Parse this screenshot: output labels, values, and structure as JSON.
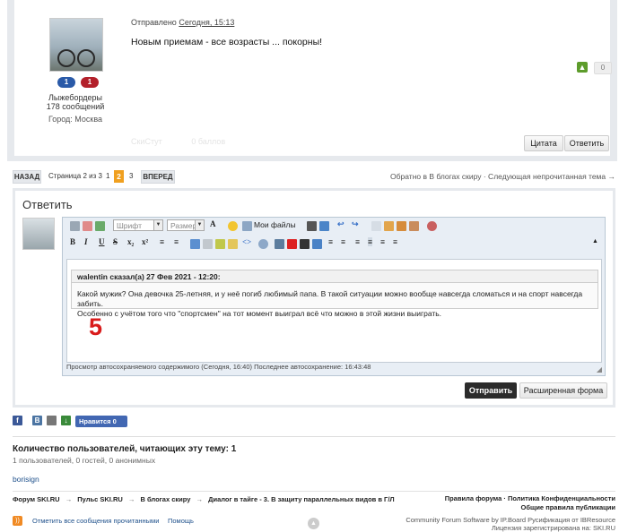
{
  "post": {
    "user_title": "Лыжебордеры",
    "user_posts": "178 сообщений",
    "user_city": "Город: Москва",
    "badges": [
      "1",
      "1"
    ],
    "posted_prefix": "Отправлено",
    "posted_date": "Сегодня, 15:13",
    "text": "Новым приемам - все возрасты ... покорны!",
    "vote_count": "0",
    "faded_user": "СкиСтут",
    "faded_rep": "0 баллов",
    "quote_btn": "Цитата",
    "reply_btn": "Ответить"
  },
  "pagination": {
    "back": "НАЗАД",
    "info": "Страница 2 из 3",
    "pages": [
      "1",
      "2",
      "3"
    ],
    "current": "2",
    "forward": "ВПЕРЕД",
    "topic_nav": "Обратно в В блогах скиру · Следующая непрочитанная тема →"
  },
  "reply": {
    "title": "Ответить",
    "font_select": "Шрифт",
    "size_select": "Размер",
    "my_files": "Мои файлы",
    "quote_header": "walentin сказал(а) 27 Фев 2021 - 12:20:",
    "quote_line1": "Какой мужик? Она девочка 25-летняя, и у неё погиб любимый папа. В такой ситуации можно вообще навсегда сломаться и на спорт навсегда забить.",
    "quote_line2": "Особенно с учётом того что \"спортсмен\" на тот момент выиграл всё что можно в этой жизни выиграть.",
    "typed_text": "5",
    "autosave": "Просмотр автосохраняемого содержимого (Сегодня, 16:40) Последнее автосохранение: 16:43:48",
    "submit_btn": "Отправить",
    "advanced_btn": "Расширенная форма"
  },
  "social": {
    "like_label": "Нравится 0",
    "icons": [
      "facebook-icon",
      "vk-icon",
      "print-icon",
      "download-icon"
    ]
  },
  "viewers": {
    "title": "Количество пользователей, читающих эту тему: 1",
    "subtitle": "1 пользователей, 0 гостей, 0 анонимных",
    "names": [
      "borisign"
    ]
  },
  "footer": {
    "crumbs": [
      "Форум SKI.RU",
      "Пульс SKI.RU",
      "В блогах скиру",
      "Диалог в тайге - 3. В защиту параллельных видов в Г/Л"
    ],
    "crumb_sep": "→",
    "rules": "Правила форума",
    "privacy": "Политика Конфиденциальности",
    "publish_rules": "Общие правила публикации",
    "mark_read": "Отметить все сообщения прочитанными",
    "help": "Помощь",
    "copyright1": "Community Forum Software by IP.Board Русификация от IBResource",
    "copyright2": "Лицензия зарегистрирована на: SKI.RU"
  },
  "colors": {
    "accent": "#f0a020",
    "submit": "#2b2b2b",
    "big_number": "#d91c1c",
    "vote_up": "#5d9c2b",
    "fb_like": "#4267b2"
  }
}
